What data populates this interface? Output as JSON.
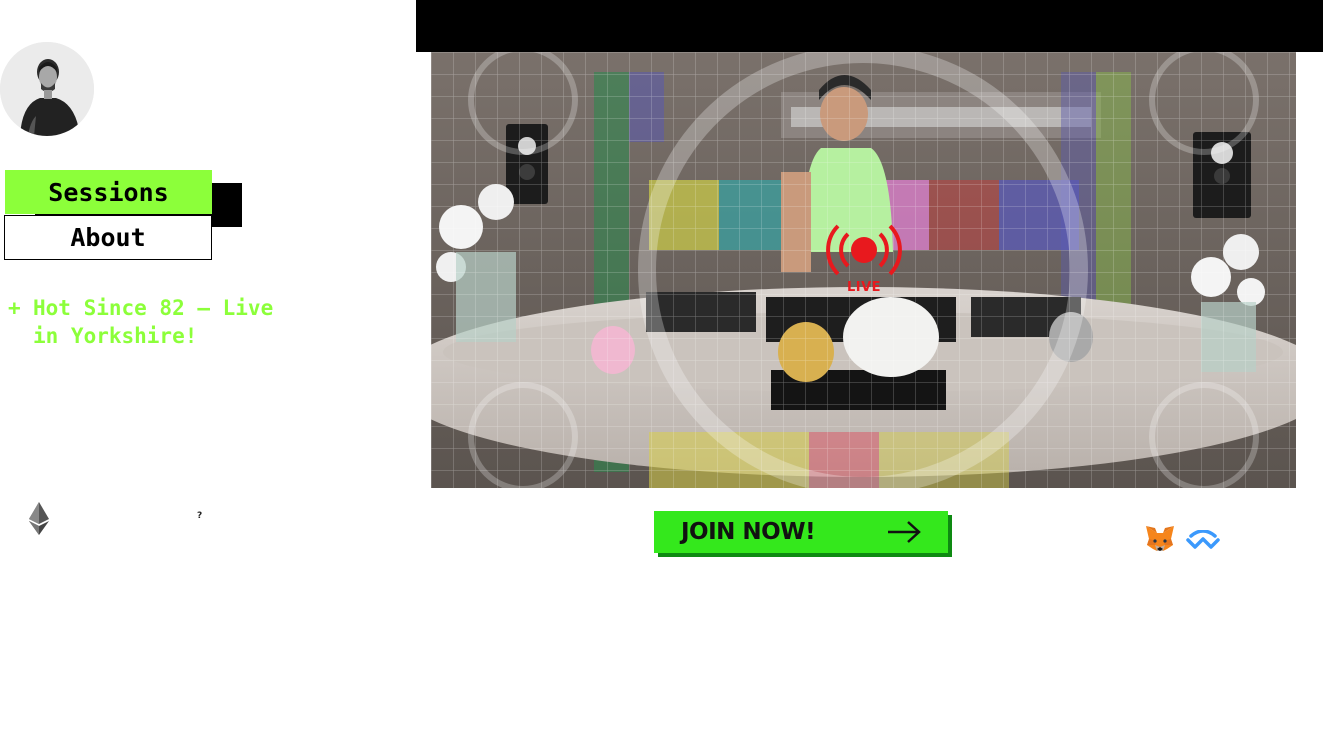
{
  "nav": {
    "tabs": [
      {
        "label": "Sessions",
        "active": true
      },
      {
        "label": "About",
        "active": false
      }
    ]
  },
  "sessions": {
    "items": [
      {
        "prefix": "+",
        "title": "Hot Since 82 – Live in Yorkshire!"
      }
    ]
  },
  "wallet": {
    "help_text": "?"
  },
  "video": {
    "live_label": "LIVE"
  },
  "cta": {
    "join_label": "JOIN NOW!"
  },
  "colors": {
    "accent_green": "#8cff3a",
    "button_green": "#34e81c",
    "live_red": "#e8191e",
    "walletconnect_blue": "#3b99fc",
    "metamask_orange": "#e2761b"
  },
  "icons": {
    "avatar": "person-avatar",
    "ethereum": "ethereum-icon",
    "live": "live-broadcast-icon",
    "arrow": "arrow-right-icon",
    "metamask": "metamask-fox-icon",
    "walletconnect": "walletconnect-icon"
  }
}
